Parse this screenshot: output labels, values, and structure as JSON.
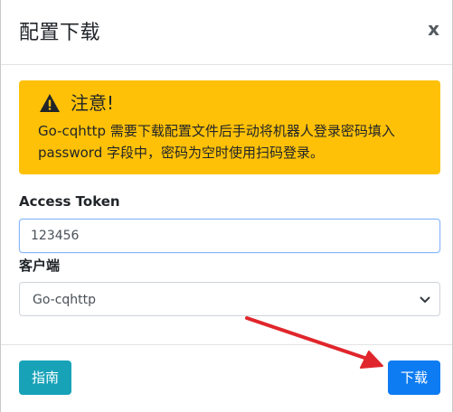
{
  "dialog": {
    "title": "配置下载",
    "close_label": "x"
  },
  "alert": {
    "heading": "注意!",
    "body": "Go-cqhttp 需要下载配置文件后手动将机器人登录密码填入 password 字段中，密码为空时使用扫码登录。",
    "icon": "warning-icon",
    "background_color": "#ffc107"
  },
  "form": {
    "token_label": "Access Token",
    "token_value": "123456",
    "client_label": "客户端",
    "client_selected": "Go-cqhttp",
    "client_icon": "chevron-down-icon"
  },
  "footer": {
    "guide_label": "指南",
    "download_label": "下载",
    "guide_color": "#17a2b8",
    "download_color": "#0d7cf2"
  },
  "annotation": {
    "arrow_color": "#e0262c"
  }
}
